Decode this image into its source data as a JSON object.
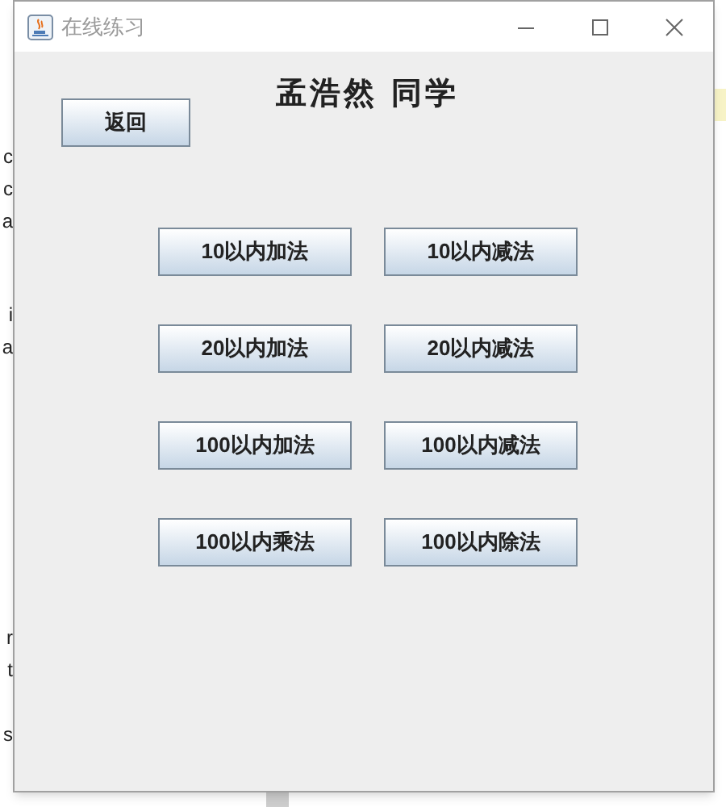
{
  "background_text": [
    "c",
    "c",
    "a",
    "i",
    "a",
    "r",
    "t",
    "s"
  ],
  "window": {
    "title": "在线练习"
  },
  "heading": "孟浩然 同学",
  "back_button": "返回",
  "exercise_buttons": [
    "10以内加法",
    "10以内减法",
    "20以内加法",
    "20以内减法",
    "100以内加法",
    "100以内减法",
    "100以内乘法",
    "100以内除法"
  ]
}
